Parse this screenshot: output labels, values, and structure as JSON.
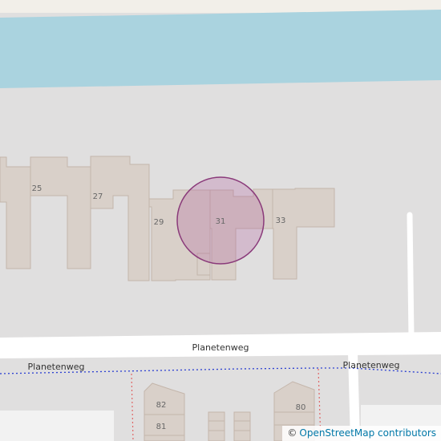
{
  "map": {
    "colors": {
      "background": "#e0dfdf",
      "water": "#aad3df",
      "building": "#d9d0c9",
      "building_outline": "#c4b6ab",
      "road": "#ffffff",
      "path_dotted": "#2b3fd1",
      "path_red": "#e06666",
      "marker_fill": "rgba(170,80,150,0.25)",
      "marker_stroke": "#8a3a7a"
    },
    "house_numbers": [
      "25",
      "27",
      "29",
      "31",
      "33",
      "82",
      "81",
      "80"
    ],
    "streets": [
      "Planetenweg",
      "Planetenweg",
      "Planetenweg"
    ],
    "marker": {
      "label": "31",
      "shape": "circle"
    }
  },
  "attribution": {
    "symbol": "©",
    "text": "OpenStreetMap contributors"
  }
}
